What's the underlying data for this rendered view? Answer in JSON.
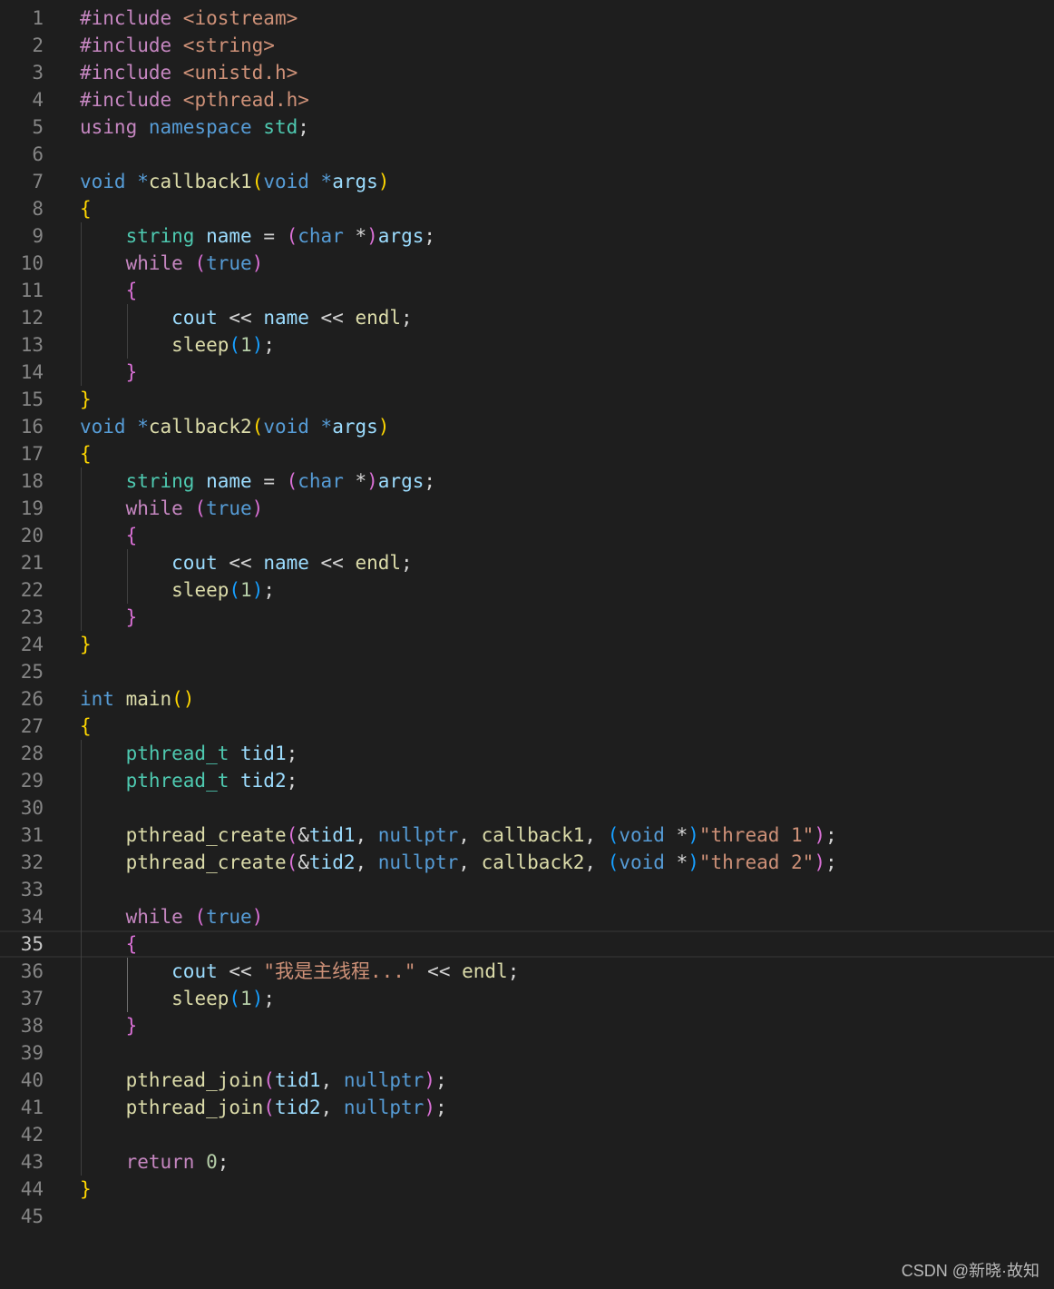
{
  "editor": {
    "active_line": 35,
    "lines": [
      {
        "n": "1",
        "tokens": [
          [
            "#include ",
            "pp"
          ],
          [
            "<iostream>",
            "str"
          ]
        ]
      },
      {
        "n": "2",
        "tokens": [
          [
            "#include ",
            "pp"
          ],
          [
            "<string>",
            "str"
          ]
        ]
      },
      {
        "n": "3",
        "tokens": [
          [
            "#include ",
            "pp"
          ],
          [
            "<unistd.h>",
            "str"
          ]
        ]
      },
      {
        "n": "4",
        "tokens": [
          [
            "#include ",
            "pp"
          ],
          [
            "<pthread.h>",
            "str"
          ]
        ]
      },
      {
        "n": "5",
        "tokens": [
          [
            "using ",
            "ctl"
          ],
          [
            "namespace ",
            "kw"
          ],
          [
            "std",
            "type"
          ],
          [
            ";",
            "plain"
          ]
        ]
      },
      {
        "n": "6",
        "tokens": []
      },
      {
        "n": "7",
        "tokens": [
          [
            "void ",
            "kw"
          ],
          [
            "*",
            "kw"
          ],
          [
            "callback1",
            "fn"
          ],
          [
            "(",
            "p1"
          ],
          [
            "void ",
            "kw"
          ],
          [
            "*",
            "kw"
          ],
          [
            "args",
            "var"
          ],
          [
            ")",
            "p1"
          ]
        ]
      },
      {
        "n": "8",
        "tokens": [
          [
            "{",
            "p1"
          ]
        ]
      },
      {
        "n": "9",
        "tokens": [
          [
            "    ",
            "plain"
          ],
          [
            "string ",
            "type"
          ],
          [
            "name ",
            "var"
          ],
          [
            "= ",
            "op"
          ],
          [
            "(",
            "p2"
          ],
          [
            "char ",
            "kw"
          ],
          [
            "*",
            "op"
          ],
          [
            ")",
            "p2"
          ],
          [
            "args",
            "var"
          ],
          [
            ";",
            "plain"
          ]
        ]
      },
      {
        "n": "10",
        "tokens": [
          [
            "    ",
            "plain"
          ],
          [
            "while ",
            "ctl"
          ],
          [
            "(",
            "p2"
          ],
          [
            "true",
            "kw"
          ],
          [
            ")",
            "p2"
          ]
        ]
      },
      {
        "n": "11",
        "tokens": [
          [
            "    ",
            "plain"
          ],
          [
            "{",
            "p2"
          ]
        ]
      },
      {
        "n": "12",
        "tokens": [
          [
            "        ",
            "plain"
          ],
          [
            "cout ",
            "var"
          ],
          [
            "<< ",
            "op"
          ],
          [
            "name ",
            "var"
          ],
          [
            "<< ",
            "op"
          ],
          [
            "endl",
            "fn"
          ],
          [
            ";",
            "plain"
          ]
        ]
      },
      {
        "n": "13",
        "tokens": [
          [
            "        ",
            "plain"
          ],
          [
            "sleep",
            "fn"
          ],
          [
            "(",
            "p3"
          ],
          [
            "1",
            "num"
          ],
          [
            ")",
            "p3"
          ],
          [
            ";",
            "plain"
          ]
        ]
      },
      {
        "n": "14",
        "tokens": [
          [
            "    ",
            "plain"
          ],
          [
            "}",
            "p2"
          ]
        ]
      },
      {
        "n": "15",
        "tokens": [
          [
            "}",
            "p1"
          ]
        ]
      },
      {
        "n": "16",
        "tokens": [
          [
            "void ",
            "kw"
          ],
          [
            "*",
            "kw"
          ],
          [
            "callback2",
            "fn"
          ],
          [
            "(",
            "p1"
          ],
          [
            "void ",
            "kw"
          ],
          [
            "*",
            "kw"
          ],
          [
            "args",
            "var"
          ],
          [
            ")",
            "p1"
          ]
        ]
      },
      {
        "n": "17",
        "tokens": [
          [
            "{",
            "p1"
          ]
        ]
      },
      {
        "n": "18",
        "tokens": [
          [
            "    ",
            "plain"
          ],
          [
            "string ",
            "type"
          ],
          [
            "name ",
            "var"
          ],
          [
            "= ",
            "op"
          ],
          [
            "(",
            "p2"
          ],
          [
            "char ",
            "kw"
          ],
          [
            "*",
            "op"
          ],
          [
            ")",
            "p2"
          ],
          [
            "args",
            "var"
          ],
          [
            ";",
            "plain"
          ]
        ]
      },
      {
        "n": "19",
        "tokens": [
          [
            "    ",
            "plain"
          ],
          [
            "while ",
            "ctl"
          ],
          [
            "(",
            "p2"
          ],
          [
            "true",
            "kw"
          ],
          [
            ")",
            "p2"
          ]
        ]
      },
      {
        "n": "20",
        "tokens": [
          [
            "    ",
            "plain"
          ],
          [
            "{",
            "p2"
          ]
        ]
      },
      {
        "n": "21",
        "tokens": [
          [
            "        ",
            "plain"
          ],
          [
            "cout ",
            "var"
          ],
          [
            "<< ",
            "op"
          ],
          [
            "name ",
            "var"
          ],
          [
            "<< ",
            "op"
          ],
          [
            "endl",
            "fn"
          ],
          [
            ";",
            "plain"
          ]
        ]
      },
      {
        "n": "22",
        "tokens": [
          [
            "        ",
            "plain"
          ],
          [
            "sleep",
            "fn"
          ],
          [
            "(",
            "p3"
          ],
          [
            "1",
            "num"
          ],
          [
            ")",
            "p3"
          ],
          [
            ";",
            "plain"
          ]
        ]
      },
      {
        "n": "23",
        "tokens": [
          [
            "    ",
            "plain"
          ],
          [
            "}",
            "p2"
          ]
        ]
      },
      {
        "n": "24",
        "tokens": [
          [
            "}",
            "p1"
          ]
        ]
      },
      {
        "n": "25",
        "tokens": []
      },
      {
        "n": "26",
        "tokens": [
          [
            "int ",
            "kw"
          ],
          [
            "main",
            "fn"
          ],
          [
            "()",
            "p1"
          ]
        ]
      },
      {
        "n": "27",
        "tokens": [
          [
            "{",
            "p1"
          ]
        ]
      },
      {
        "n": "28",
        "tokens": [
          [
            "    ",
            "plain"
          ],
          [
            "pthread_t ",
            "type"
          ],
          [
            "tid1",
            "var"
          ],
          [
            ";",
            "plain"
          ]
        ]
      },
      {
        "n": "29",
        "tokens": [
          [
            "    ",
            "plain"
          ],
          [
            "pthread_t ",
            "type"
          ],
          [
            "tid2",
            "var"
          ],
          [
            ";",
            "plain"
          ]
        ]
      },
      {
        "n": "30",
        "tokens": []
      },
      {
        "n": "31",
        "tokens": [
          [
            "    ",
            "plain"
          ],
          [
            "pthread_create",
            "fn"
          ],
          [
            "(",
            "p2"
          ],
          [
            "&",
            "op"
          ],
          [
            "tid1",
            "var"
          ],
          [
            ", ",
            "plain"
          ],
          [
            "nullptr",
            "kw"
          ],
          [
            ", ",
            "plain"
          ],
          [
            "callback1",
            "fn"
          ],
          [
            ", ",
            "plain"
          ],
          [
            "(",
            "p3"
          ],
          [
            "void ",
            "kw"
          ],
          [
            "*",
            "op"
          ],
          [
            ")",
            "p3"
          ],
          [
            "\"thread 1\"",
            "str"
          ],
          [
            ")",
            "p2"
          ],
          [
            ";",
            "plain"
          ]
        ]
      },
      {
        "n": "32",
        "tokens": [
          [
            "    ",
            "plain"
          ],
          [
            "pthread_create",
            "fn"
          ],
          [
            "(",
            "p2"
          ],
          [
            "&",
            "op"
          ],
          [
            "tid2",
            "var"
          ],
          [
            ", ",
            "plain"
          ],
          [
            "nullptr",
            "kw"
          ],
          [
            ", ",
            "plain"
          ],
          [
            "callback2",
            "fn"
          ],
          [
            ", ",
            "plain"
          ],
          [
            "(",
            "p3"
          ],
          [
            "void ",
            "kw"
          ],
          [
            "*",
            "op"
          ],
          [
            ")",
            "p3"
          ],
          [
            "\"thread 2\"",
            "str"
          ],
          [
            ")",
            "p2"
          ],
          [
            ";",
            "plain"
          ]
        ]
      },
      {
        "n": "33",
        "tokens": []
      },
      {
        "n": "34",
        "tokens": [
          [
            "    ",
            "plain"
          ],
          [
            "while ",
            "ctl"
          ],
          [
            "(",
            "p2"
          ],
          [
            "true",
            "kw"
          ],
          [
            ")",
            "p2"
          ]
        ]
      },
      {
        "n": "35",
        "tokens": [
          [
            "    ",
            "plain"
          ],
          [
            "{",
            "p2"
          ]
        ]
      },
      {
        "n": "36",
        "tokens": [
          [
            "        ",
            "plain"
          ],
          [
            "cout ",
            "var"
          ],
          [
            "<< ",
            "op"
          ],
          [
            "\"我是主线程...\" ",
            "str"
          ],
          [
            "<< ",
            "op"
          ],
          [
            "endl",
            "fn"
          ],
          [
            ";",
            "plain"
          ]
        ]
      },
      {
        "n": "37",
        "tokens": [
          [
            "        ",
            "plain"
          ],
          [
            "sleep",
            "fn"
          ],
          [
            "(",
            "p3"
          ],
          [
            "1",
            "num"
          ],
          [
            ")",
            "p3"
          ],
          [
            ";",
            "plain"
          ]
        ]
      },
      {
        "n": "38",
        "tokens": [
          [
            "    ",
            "plain"
          ],
          [
            "}",
            "p2"
          ]
        ]
      },
      {
        "n": "39",
        "tokens": []
      },
      {
        "n": "40",
        "tokens": [
          [
            "    ",
            "plain"
          ],
          [
            "pthread_join",
            "fn"
          ],
          [
            "(",
            "p2"
          ],
          [
            "tid1",
            "var"
          ],
          [
            ", ",
            "plain"
          ],
          [
            "nullptr",
            "kw"
          ],
          [
            ")",
            "p2"
          ],
          [
            ";",
            "plain"
          ]
        ]
      },
      {
        "n": "41",
        "tokens": [
          [
            "    ",
            "plain"
          ],
          [
            "pthread_join",
            "fn"
          ],
          [
            "(",
            "p2"
          ],
          [
            "tid2",
            "var"
          ],
          [
            ", ",
            "plain"
          ],
          [
            "nullptr",
            "kw"
          ],
          [
            ")",
            "p2"
          ],
          [
            ";",
            "plain"
          ]
        ]
      },
      {
        "n": "42",
        "tokens": []
      },
      {
        "n": "43",
        "tokens": [
          [
            "    ",
            "plain"
          ],
          [
            "return ",
            "ctl"
          ],
          [
            "0",
            "num"
          ],
          [
            ";",
            "plain"
          ]
        ]
      },
      {
        "n": "44",
        "tokens": [
          [
            "}",
            "p1"
          ]
        ]
      },
      {
        "n": "45",
        "tokens": []
      }
    ]
  },
  "watermark": "CSDN @新晓·故知"
}
